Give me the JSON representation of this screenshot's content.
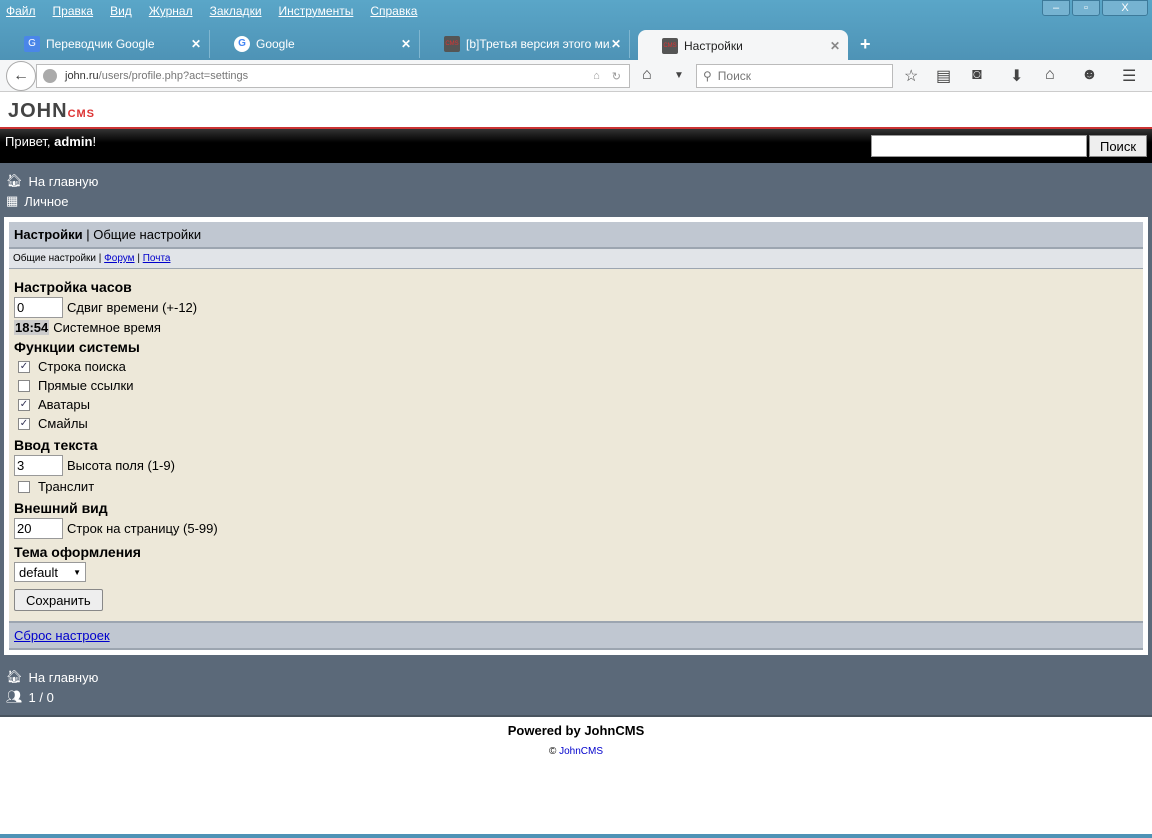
{
  "browser": {
    "menu": [
      "Файл",
      "Правка",
      "Вид",
      "Журнал",
      "Закладки",
      "Инструменты",
      "Справка"
    ],
    "tabs": [
      {
        "label": "Переводчик Google"
      },
      {
        "label": "Google"
      },
      {
        "label": "[b]Третья версия этого ми..."
      },
      {
        "label": "Настройки"
      }
    ],
    "url_host": "john.ru",
    "url_path": "/users/profile.php?act=settings",
    "search_placeholder": "Поиск"
  },
  "site": {
    "logo": "JOHN",
    "logo_sub": "CMS",
    "greeting": "Привет, ",
    "user": "admin",
    "greeting_end": "!",
    "search_button": "Поиск",
    "nav": [
      "На главную",
      "Личное"
    ],
    "title": "Настройки",
    "title_sep": " | ",
    "subtitle": "Общие настройки",
    "subnav": {
      "current": "Общие настройки",
      "forum": "Форум",
      "mail": "Почта",
      "sep": " | "
    },
    "clock": {
      "heading": "Настройка часов",
      "shift_value": "0",
      "shift_label": "Сдвиг времени (+-12)",
      "time": "18:54",
      "time_label": "Системное время"
    },
    "system": {
      "heading": "Функции системы",
      "options": [
        {
          "label": "Строка поиска",
          "checked": true
        },
        {
          "label": "Прямые ссылки",
          "checked": false
        },
        {
          "label": "Аватары",
          "checked": true
        },
        {
          "label": "Смайлы",
          "checked": true
        }
      ]
    },
    "input": {
      "heading": "Ввод текста",
      "height_value": "3",
      "height_label": "Высота поля (1-9)",
      "translit": "Транслит"
    },
    "view": {
      "heading": "Внешний вид",
      "rows_value": "20",
      "rows_label": "Строк на страницу (5-99)"
    },
    "theme": {
      "heading": "Тема оформления",
      "selected": "default"
    },
    "save": "Сохранить",
    "reset": "Сброс настроек",
    "footer_nav": {
      "home": "На главную",
      "online": "1 / 0"
    },
    "powered": "Powered by JohnCMS",
    "copy": "©",
    "copy_link": "JohnCMS"
  }
}
